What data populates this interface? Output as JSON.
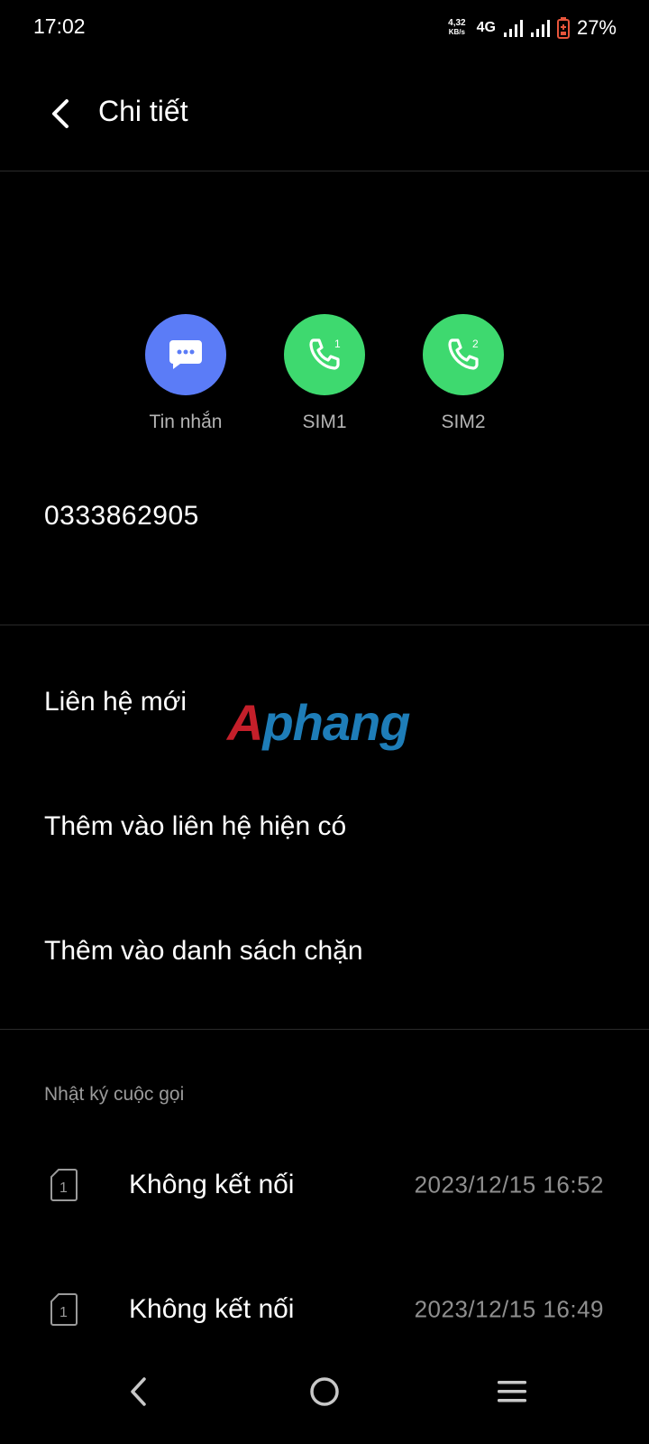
{
  "status_bar": {
    "time": "17:02",
    "net_speed_value": "4,32",
    "net_speed_unit": "KB/s",
    "network_type": "4G",
    "battery_percent": "27%"
  },
  "header": {
    "title": "Chi tiết"
  },
  "actions": [
    {
      "label": "Tin nhắn",
      "icon": "message-icon",
      "color": "#5b7cf7"
    },
    {
      "label": "SIM1",
      "icon": "phone-sim1-icon",
      "color": "#3ed96f",
      "badge": "1"
    },
    {
      "label": "SIM2",
      "icon": "phone-sim2-icon",
      "color": "#3ed96f",
      "badge": "2"
    }
  ],
  "phone_number": "0333862905",
  "menu": {
    "new_contact": "Liên hệ mới",
    "add_to_existing": "Thêm vào liên hệ hiện có",
    "add_to_blocklist": "Thêm vào danh sách chặn"
  },
  "watermark": {
    "first_letter": "A",
    "rest": "phang"
  },
  "call_log": {
    "title": "Nhật ký cuộc gọi",
    "entries": [
      {
        "sim": "1",
        "status": "Không kết nối",
        "time": "2023/12/15 16:52"
      },
      {
        "sim": "1",
        "status": "Không kết nối",
        "time": "2023/12/15 16:49"
      }
    ]
  }
}
